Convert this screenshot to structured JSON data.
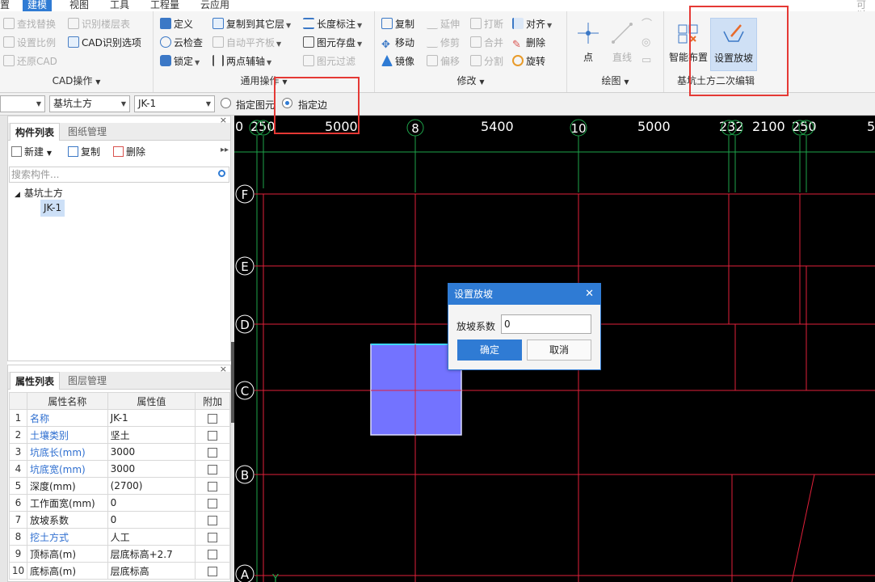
{
  "menu": [
    "置",
    "建模",
    "视图",
    "工具",
    "工程量",
    "云应用",
    "可以"
  ],
  "ribbon": {
    "cad_group": {
      "label": "CAD操作",
      "buttons": [
        "查找替换",
        "识别楼层表",
        "设置比例",
        "CAD识别选项",
        "还原CAD"
      ]
    },
    "general_group": {
      "label": "通用操作",
      "buttons": [
        "定义",
        "复制到其它层",
        "长度标注",
        "云检查",
        "自动平齐板",
        "图元存盘",
        "锁定",
        "两点辅轴",
        "图元过滤"
      ]
    },
    "modify_group": {
      "label": "修改",
      "buttons": [
        "复制",
        "延伸",
        "打断",
        "对齐",
        "移动",
        "修剪",
        "合并",
        "删除",
        "镜像",
        "偏移",
        "分割",
        "旋转"
      ]
    },
    "draw_group": {
      "label": "绘图",
      "buttons": [
        "点",
        "直线"
      ]
    },
    "pit_group": {
      "label": "基坑土方二次编辑",
      "buttons": [
        "智能布置",
        "设置放坡"
      ]
    }
  },
  "optionbar": {
    "combo1": "",
    "combo2": "基坑土方",
    "combo3": "JK-1",
    "radio1": "指定图元",
    "radio2": "指定边"
  },
  "component_panel": {
    "tabs": [
      "构件列表",
      "图纸管理"
    ],
    "tools": [
      "新建",
      "复制",
      "删除"
    ],
    "search_placeholder": "搜索构件...",
    "tree_root": "基坑土方",
    "tree_child": "JK-1"
  },
  "property_panel": {
    "tabs": [
      "属性列表",
      "图层管理"
    ],
    "headers": [
      "属性名称",
      "属性值",
      "附加"
    ],
    "rows": [
      {
        "no": "1",
        "name": "名称",
        "value": "JK-1",
        "blue": true
      },
      {
        "no": "2",
        "name": "土壤类别",
        "value": "坚土",
        "blue": true
      },
      {
        "no": "3",
        "name": "坑底长(mm)",
        "value": "3000",
        "blue": true
      },
      {
        "no": "4",
        "name": "坑底宽(mm)",
        "value": "3000",
        "blue": true
      },
      {
        "no": "5",
        "name": "深度(mm)",
        "value": "(2700)",
        "blue": false
      },
      {
        "no": "6",
        "name": "工作面宽(mm)",
        "value": "0",
        "blue": false
      },
      {
        "no": "7",
        "name": "放坡系数",
        "value": "0",
        "blue": false
      },
      {
        "no": "8",
        "name": "挖土方式",
        "value": "人工",
        "blue": true
      },
      {
        "no": "9",
        "name": "顶标高(m)",
        "value": "层底标高+2.7",
        "blue": false
      },
      {
        "no": "10",
        "name": "底标高(m)",
        "value": "层底标高",
        "blue": false
      }
    ]
  },
  "canvas": {
    "top_labels": [
      "0",
      "250",
      "5000",
      "8",
      "5400",
      "10",
      "5000",
      "232",
      "2100",
      "250",
      "5"
    ],
    "axis_rows": [
      "F",
      "E",
      "D",
      "C",
      "B",
      "A"
    ],
    "y_marker": "Y"
  },
  "dialog": {
    "title": "设置放坡",
    "field_label": "放坡系数",
    "field_value": "0",
    "ok": "确定",
    "cancel": "取消"
  },
  "colors": {
    "accent": "#2f7bd4",
    "grid_red": "#e0203a",
    "grid_green": "#1ea34a",
    "pit_fill": "#7373ff",
    "highlight_box": "#e53935"
  }
}
